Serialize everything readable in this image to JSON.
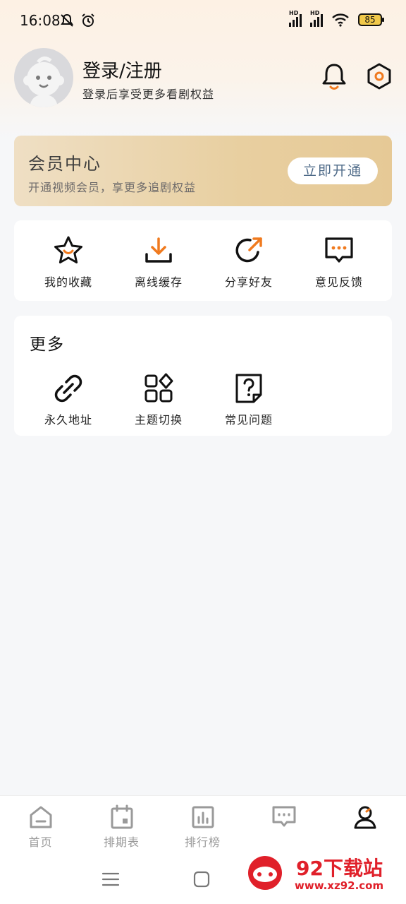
{
  "status_bar": {
    "time": "16:08",
    "signal1_label": "HD",
    "signal2_label": "HD",
    "battery": "85"
  },
  "header": {
    "title": "登录/注册",
    "subtitle": "登录后享受更多看剧权益",
    "icons": [
      "avatar",
      "bell-icon",
      "settings-icon"
    ]
  },
  "vip": {
    "title": "会员中心",
    "subtitle": "开通视频会员，享更多追剧权益",
    "button": "立即开通"
  },
  "actions": [
    {
      "label": "我的收藏",
      "icon": "star-icon"
    },
    {
      "label": "离线缓存",
      "icon": "download-icon"
    },
    {
      "label": "分享好友",
      "icon": "share-icon"
    },
    {
      "label": "意见反馈",
      "icon": "feedback-icon"
    }
  ],
  "more": {
    "title": "更多",
    "items": [
      {
        "label": "永久地址",
        "icon": "link-icon"
      },
      {
        "label": "主题切换",
        "icon": "theme-icon"
      },
      {
        "label": "常见问题",
        "icon": "faq-icon"
      }
    ]
  },
  "bottom_nav": [
    {
      "label": "首页",
      "icon": "home-icon"
    },
    {
      "label": "排期表",
      "icon": "calendar-icon"
    },
    {
      "label": "排行榜",
      "icon": "chart-icon"
    },
    {
      "label": "",
      "icon": "message-icon"
    },
    {
      "label": "",
      "icon": "profile-icon"
    }
  ],
  "watermark": {
    "text": "92下载站",
    "url": "www.xz92.com"
  },
  "colors": {
    "accent": "#f07a1e",
    "vip_gold": "#e8cfa0",
    "nav_inactive": "#9a9a9a",
    "link_blue": "#4e6a88"
  }
}
